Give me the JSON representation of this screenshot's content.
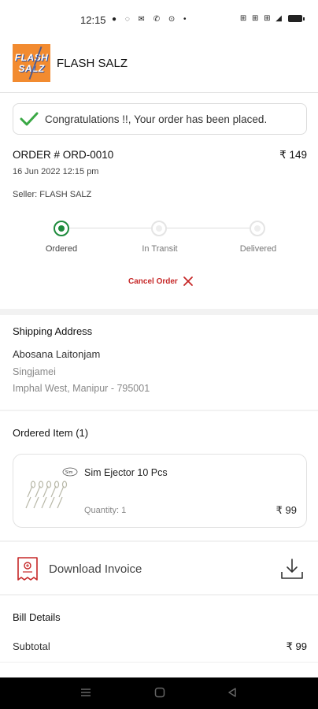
{
  "status_bar": {
    "time": "12:15",
    "left_icons": "● ◌ ✉ ✆ ⊙ •",
    "right_icons": "⊞ ⊞ ⊞ ◢"
  },
  "header": {
    "logo_text_top": "FLASH",
    "logo_text_bottom": "SALZ",
    "store_name": "FLASH SALZ"
  },
  "order": {
    "success_message": "Congratulations !!, Your order has been placed.",
    "order_number": "ORDER # ORD-0010",
    "total": "₹ 149",
    "date": "16 Jun 2022 12:15 pm",
    "seller": "Seller: FLASH SALZ",
    "steps": [
      {
        "label": "Ordered",
        "active": true
      },
      {
        "label": "In Transit",
        "active": false
      },
      {
        "label": "Delivered",
        "active": false
      }
    ],
    "cancel_label": "Cancel Order"
  },
  "shipping": {
    "title": "Shipping Address",
    "name": "Abosana Laitonjam",
    "line1": "Singjamei",
    "line2": "Imphal West, Manipur - 795001"
  },
  "items": {
    "title": "Ordered Item (1)",
    "list": [
      {
        "name": "Sim Ejector 10 Pcs",
        "quantity": "Quantity: 1",
        "price": "₹ 99",
        "image_icon": "sim-ejector-pins-image"
      }
    ]
  },
  "invoice": {
    "label": "Download Invoice"
  },
  "bill": {
    "title": "Bill Details",
    "subtotal_label": "Subtotal",
    "subtotal_value": "₹ 99"
  },
  "colors": {
    "accent_green": "#1e8b3c",
    "cancel_red": "#c62828",
    "logo_orange": "#f28b30"
  }
}
